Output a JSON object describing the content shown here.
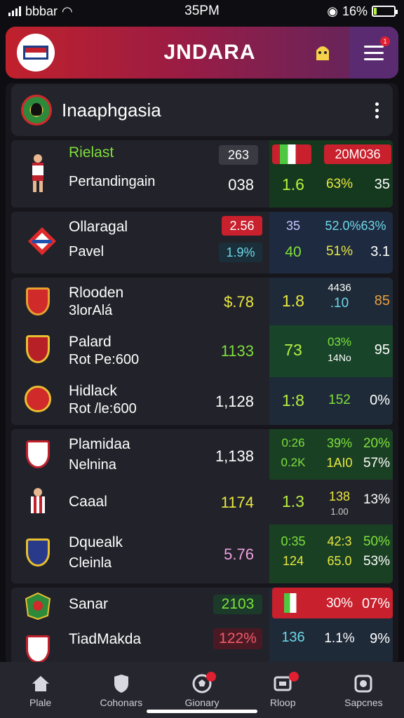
{
  "status_bar": {
    "carrier": "bbbar",
    "time": "35PM",
    "battery_pct": "16%",
    "battery_level": 0.16
  },
  "header": {
    "title": "JNDARA",
    "menu_badge": "1"
  },
  "league": {
    "name": "Inaaphgasia"
  },
  "matches": [
    {
      "team1": "Rielast",
      "team2": "Pertandingain",
      "score_top": "263",
      "score": "038",
      "odd1": "1.6",
      "odd2": "63%",
      "odd3": "35",
      "badge_right": "20M036"
    },
    {
      "team1": "Ollaragal",
      "team2": "Pavel",
      "score_top": "2.56",
      "score": "1.9%",
      "odd1": "40",
      "odd2": "51%",
      "odd3": "3.1",
      "odd_top_a": "35",
      "odd_top_b": "52.0%63%"
    },
    {
      "team1": "Rlooden",
      "team2": "3lorAlá",
      "score": "$.78",
      "odd1": "1.8",
      "odd2_top": "4436",
      "odd2": ".10",
      "odd3": "85"
    },
    {
      "team1": "Palard",
      "team2": "Rot Pe:600",
      "score": "1133",
      "odd1": "73",
      "odd2": "03%",
      "odd2_sub": "14No",
      "odd3": "95"
    },
    {
      "team1": "Hidlack",
      "team2": "Rot /le:600",
      "score": "1,128",
      "odd1": "1:8",
      "odd2": "152",
      "odd3": "0%"
    },
    {
      "team1": "Plamidaa",
      "team2": "Nelnina",
      "score": "1,138",
      "odd1_top": "0:26",
      "odd1": "0.2K",
      "odd2_top": "39%",
      "odd2": "1AI0",
      "odd3_top": "20%",
      "odd3": "57%"
    },
    {
      "team1": "Caaal",
      "score": "1174",
      "odd1": "1.3",
      "odd2": "138",
      "odd2_sub": "1.00",
      "odd3": "13%"
    },
    {
      "team1": "Dquealk",
      "team2": "Cleinla",
      "score": "5.76",
      "odd1_top": "0:35",
      "odd1": "124",
      "odd2_top": "42:3",
      "odd2": "65.0",
      "odd3_top": "50%",
      "odd3": "53%"
    },
    {
      "team1": "Sanar",
      "score": "2103",
      "odd2": "30%",
      "odd3": "07%"
    },
    {
      "team1": "TiadMakda",
      "score": "122%",
      "odd1": "136",
      "odd2": "1.1%",
      "odd3": "9%"
    }
  ],
  "tabs": [
    {
      "label": "Plale",
      "icon": "home-icon"
    },
    {
      "label": "Cohonars",
      "icon": "shield-icon"
    },
    {
      "label": "Gionary",
      "icon": "ball-icon"
    },
    {
      "label": "Rloop",
      "icon": "ticket-icon"
    },
    {
      "label": "Sapcnes",
      "icon": "settings-icon"
    }
  ]
}
